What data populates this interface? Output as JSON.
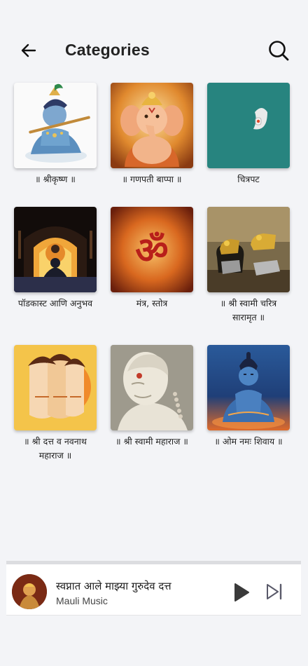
{
  "header": {
    "title": "Categories",
    "back_icon": "arrow-left-icon",
    "search_icon": "search-icon"
  },
  "categories": [
    {
      "label": "॥ श्रीकृष्ण ॥",
      "image": "krishna"
    },
    {
      "label": "॥ गणपती बाप्पा ॥",
      "image": "ganpati"
    },
    {
      "label": "चित्रपट",
      "image": "crescent-moon"
    },
    {
      "label": "पॉडकास्ट आणि अनुभव",
      "image": "meditation-temple"
    },
    {
      "label": "मंत्र, स्तोत्र",
      "image": "om"
    },
    {
      "label": "॥ श्री स्वामी चरित्र सारामृत ॥",
      "image": "golden-padukas"
    },
    {
      "label": "॥ श्री दत्त व नवनाथ महाराज ॥",
      "image": "datta"
    },
    {
      "label": "॥ श्री स्वामी महाराज ॥",
      "image": "swami-statue"
    },
    {
      "label": "॥ ओम नमः शिवाय ॥",
      "image": "shiva"
    }
  ],
  "player": {
    "title": "स्वप्नात आले माझ्या गुरुदेव दत्त",
    "artist": "Mauli Music",
    "play_icon": "play-icon",
    "next_icon": "skip-next-icon"
  },
  "colors": {
    "background": "#f3f4f7",
    "text": "#232323"
  }
}
